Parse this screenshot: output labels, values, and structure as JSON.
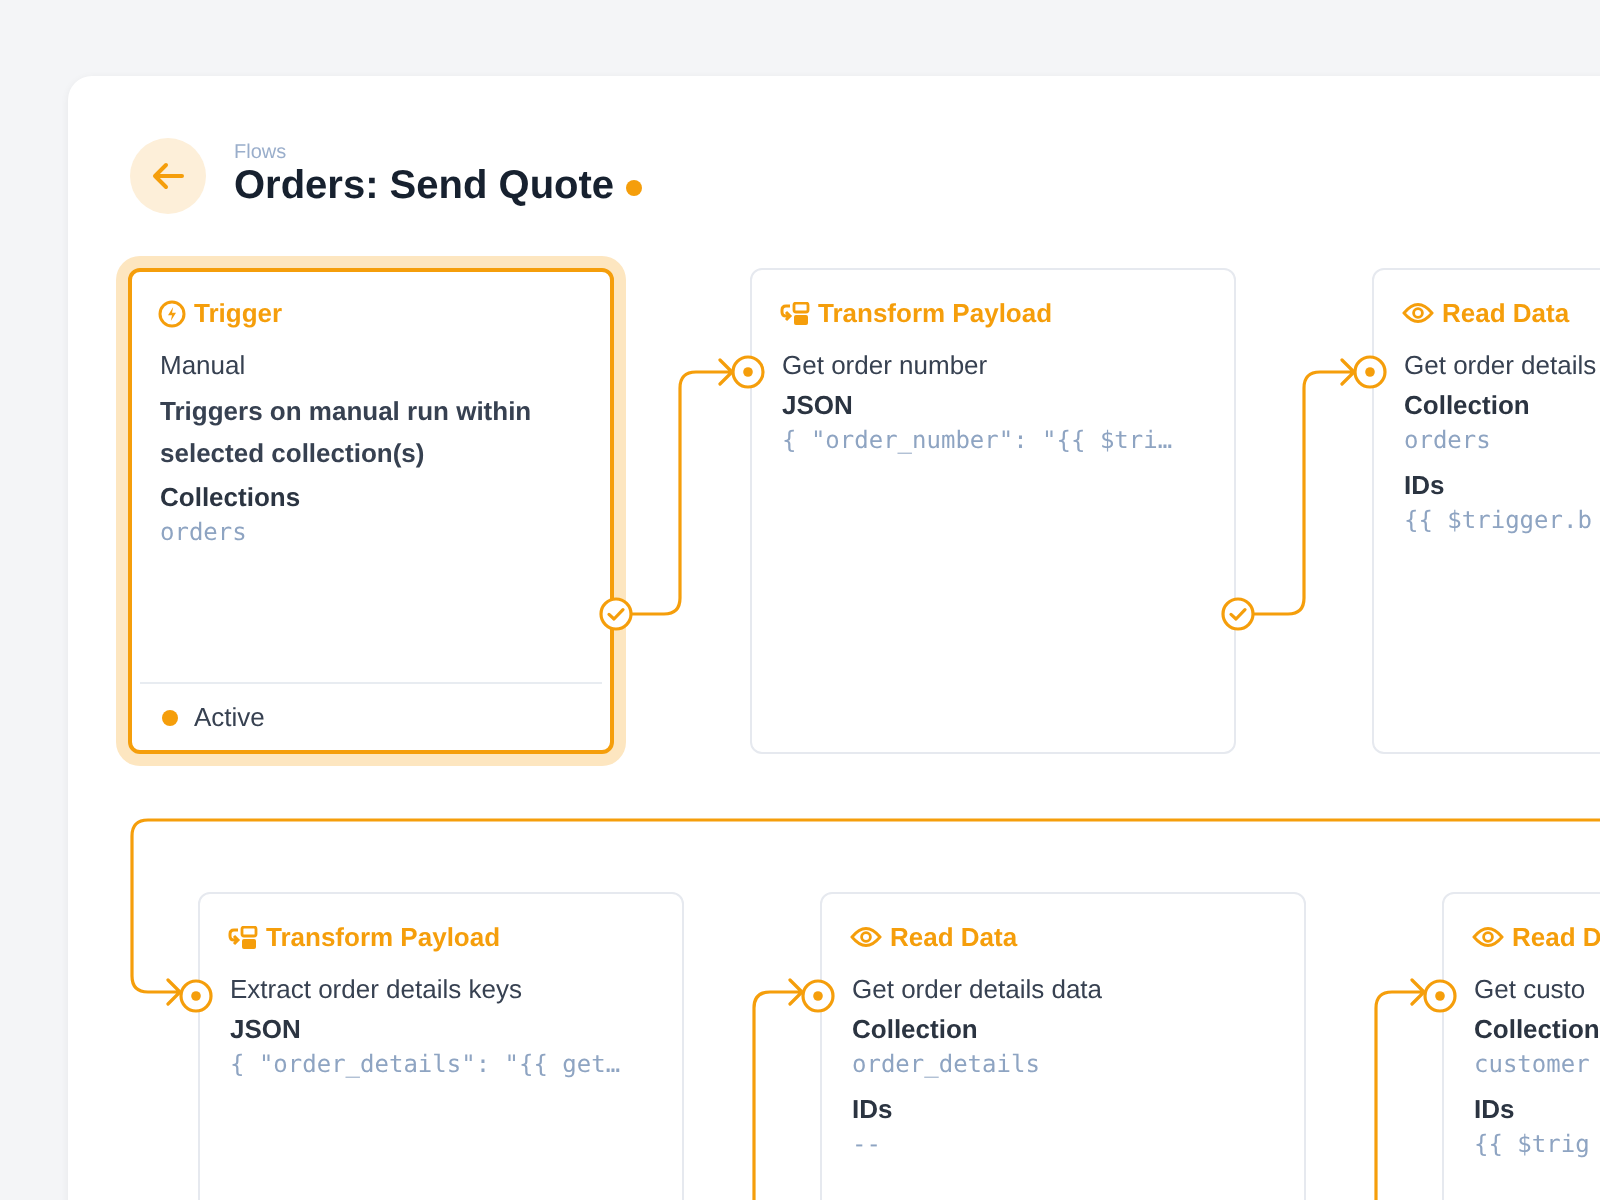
{
  "breadcrumb": "Flows",
  "title": "Orders: Send Quote",
  "unsaved": true,
  "nodes": [
    {
      "kind": "trigger",
      "title": "Trigger",
      "selected": true,
      "subtitle": "Manual",
      "description": "Triggers on manual run within selected collection(s)",
      "fields": [
        {
          "label": "Collections",
          "value": "orders"
        }
      ],
      "status": "Active",
      "success_link": true
    },
    {
      "kind": "transform",
      "title": "Transform Payload",
      "selected": false,
      "subtitle": "Get order number",
      "fields": [
        {
          "label": "JSON",
          "value": "{ \"order_number\": \"{{ $tri…"
        }
      ],
      "success_link": true
    },
    {
      "kind": "read",
      "title": "Read Data",
      "selected": false,
      "subtitle": "Get order details",
      "fields": [
        {
          "label": "Collection",
          "value": "orders"
        },
        {
          "label": "IDs",
          "value": "{{ $trigger.b"
        }
      ]
    },
    {
      "kind": "transform",
      "title": "Transform Payload",
      "selected": false,
      "subtitle": "Extract order details keys",
      "fields": [
        {
          "label": "JSON",
          "value": "{ \"order_details\": \"{{ get…"
        }
      ]
    },
    {
      "kind": "read",
      "title": "Read Data",
      "selected": false,
      "subtitle": "Get order details data",
      "fields": [
        {
          "label": "Collection",
          "value": "order_details"
        },
        {
          "label": "IDs",
          "value": "--"
        }
      ]
    },
    {
      "kind": "read",
      "title": "Read D",
      "selected": false,
      "subtitle": "Get custo",
      "fields": [
        {
          "label": "Collection",
          "value": "customer"
        },
        {
          "label": "IDs",
          "value": "{{ $trig"
        }
      ]
    }
  ]
}
